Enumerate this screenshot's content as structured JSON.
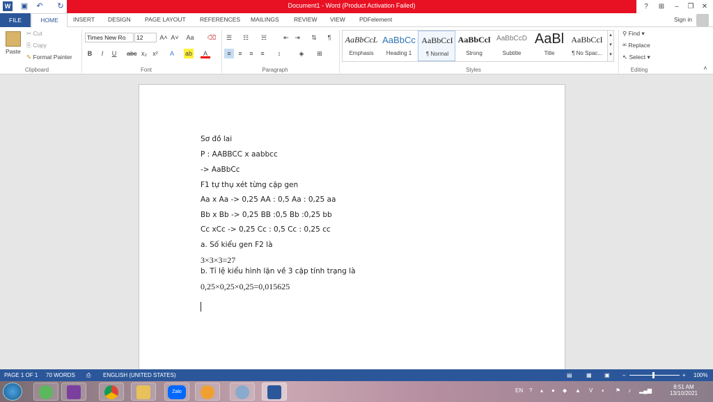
{
  "window": {
    "title": "Document1 - Word (Product Activation Failed)"
  },
  "tabs": {
    "file": "FILE",
    "home": "HOME",
    "items": [
      "INSERT",
      "DESIGN",
      "PAGE LAYOUT",
      "REFERENCES",
      "MAILINGS",
      "REVIEW",
      "VIEW",
      "PDFelement"
    ],
    "sign_in": "Sign in"
  },
  "ribbon": {
    "clipboard": {
      "paste": "Paste",
      "cut": "Cut",
      "copy": "Copy",
      "format_painter": "Format Painter",
      "label": "Clipboard"
    },
    "font": {
      "family": "Times New Ro",
      "size": "12",
      "label": "Font"
    },
    "paragraph": {
      "label": "Paragraph"
    },
    "styles": {
      "label": "Styles",
      "items": [
        {
          "preview": "AaBbCcL",
          "name": "Emphasis"
        },
        {
          "preview": "AaBbCc",
          "name": "Heading 1"
        },
        {
          "preview": "AaBbCcI",
          "name": "¶ Normal"
        },
        {
          "preview": "AaBbCcl",
          "name": "Strong"
        },
        {
          "preview": "AaBbCcD",
          "name": "Subtitle"
        },
        {
          "preview": "AaBl",
          "name": "Title"
        },
        {
          "preview": "AaBbCcI",
          "name": "¶ No Spac..."
        }
      ]
    },
    "editing": {
      "find": "Find",
      "replace": "Replace",
      "select": "Select",
      "label": "Editing"
    }
  },
  "document": {
    "lines": [
      "Sơ đồ lai",
      "P : AABBCC x aabbcc",
      "-> AaBbCc",
      "F1 tự thụ xét từng cặp gen",
      "Aa x Aa -> 0,25 AA : 0,5 Aa : 0,25 aa",
      "Bb x Bb -> 0,25 BB :0,5 Bb :0,25 bb",
      "Cc xCc -> 0,25 Cc : 0,5 Cc : 0,25 cc",
      "a. Số kiểu gen F2 là",
      "3×3×3=27",
      "b. Tỉ lệ kiểu hình lặn về 3 cặp tính trạng là",
      "0,25×0,25×0,25=0,015625"
    ]
  },
  "status": {
    "page": "PAGE 1 OF 1",
    "words": "70 WORDS",
    "language": "ENGLISH (UNITED STATES)",
    "zoom": "100%"
  },
  "taskbar": {
    "lang": "EN",
    "time": "8:51 AM",
    "date": "13/10/2021",
    "zalo": "Zalo"
  },
  "colors": {
    "accent": "#2b579a",
    "titlebar": "#e81123"
  }
}
